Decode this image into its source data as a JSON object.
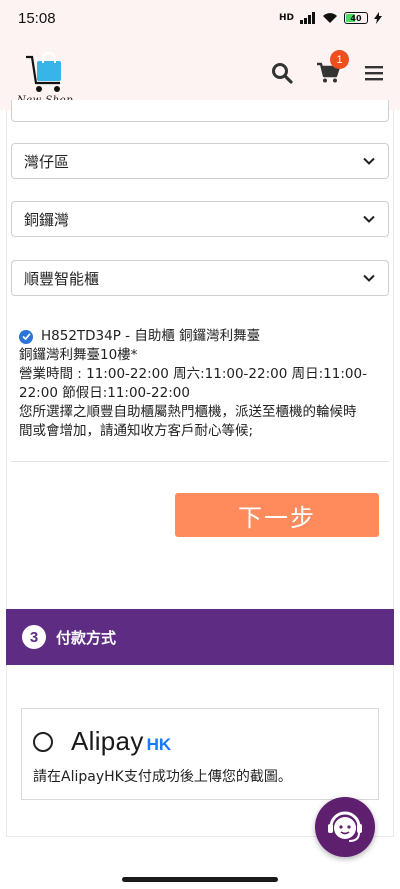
{
  "status_bar": {
    "time": "15:08",
    "network": "HD",
    "battery": "40"
  },
  "header": {
    "logo_text": "New Shop",
    "icons": [
      "search-icon",
      "cart-icon",
      "menu-icon"
    ],
    "cart_count": "1"
  },
  "delivery": {
    "district_select": "灣仔區",
    "area_select": "銅鑼灣",
    "locker_type_select": "順豐智能櫃",
    "selected_locker": {
      "code_line": "H852TD34P - 自助櫃 銅鑼灣利舞臺",
      "address": "銅鑼灣利舞臺10樓*",
      "hours_1": "營業時間 : 11:00-22:00 周六:11:00-22:00 周日:11:00-",
      "hours_2": "22:00 節假日:11:00-22:00",
      "notice_1": "您所選擇之順豐自助櫃屬熱門櫃機，派送至櫃機的輪候時",
      "notice_2": "間或會增加，請通知收方客戶耐心等候;"
    },
    "next_button": "下一步"
  },
  "payment": {
    "step_number": "3",
    "title": "付款方式",
    "method_name": "Alipay",
    "method_suffix": "HK",
    "method_desc": "請在AlipayHK支付成功後上傳您的截圖。"
  },
  "colors": {
    "header_bg": "#fdf3f3",
    "accent_orange": "#ff8a5c",
    "section_purple": "#5e2d83",
    "badge_red": "#f24d1f",
    "check_blue": "#2b74d8",
    "alipay_blue": "#1678ff"
  }
}
